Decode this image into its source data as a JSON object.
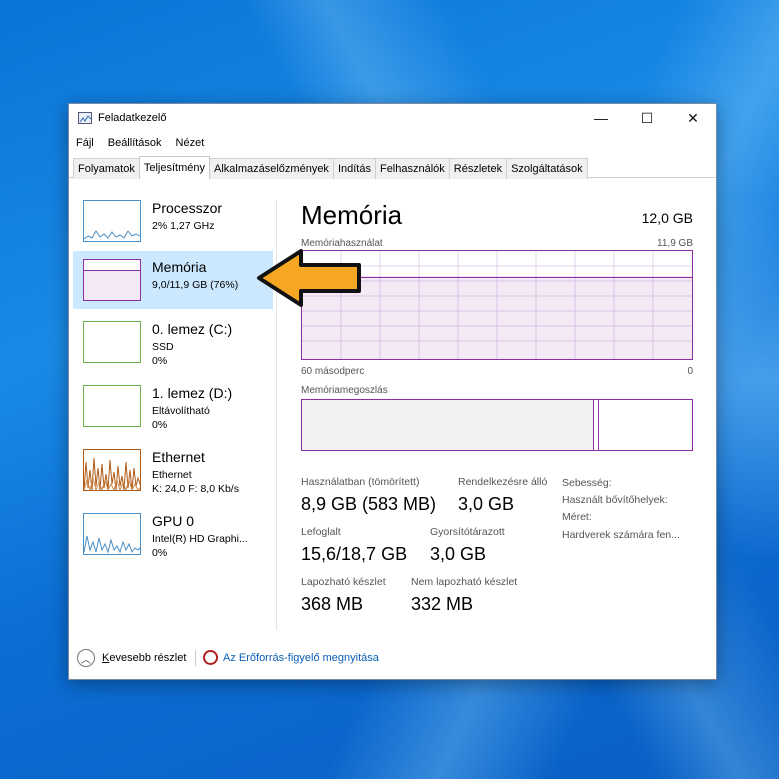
{
  "window": {
    "title": "Feladatkezelő",
    "controls": {
      "minimize": "—",
      "maximize": "☐",
      "close": "✕"
    }
  },
  "menu": [
    "Fájl",
    "Beállítások",
    "Nézet"
  ],
  "tabs": [
    {
      "label": "Folyamatok",
      "active": false
    },
    {
      "label": "Teljesítmény",
      "active": true
    },
    {
      "label": "Alkalmazáselőzmények",
      "active": false
    },
    {
      "label": "Indítás",
      "active": false
    },
    {
      "label": "Felhasználók",
      "active": false
    },
    {
      "label": "Részletek",
      "active": false
    },
    {
      "label": "Szolgáltatások",
      "active": false
    }
  ],
  "sidebar": {
    "items": [
      {
        "title": "Processzor",
        "lines": [
          "2% 1,27 GHz"
        ]
      },
      {
        "title": "Memória",
        "lines": [
          "9,0/11,9 GB (76%)"
        ],
        "selected": true
      },
      {
        "title": "0. lemez (C:)",
        "lines": [
          "SSD",
          "0%"
        ]
      },
      {
        "title": "1. lemez (D:)",
        "lines": [
          "Eltávolítható",
          "0%"
        ]
      },
      {
        "title": "Ethernet",
        "lines": [
          "Ethernet",
          "K: 24,0  F: 8,0 Kb/s"
        ]
      },
      {
        "title": "GPU 0",
        "lines": [
          "Intel(R) HD Graphi...",
          "0%"
        ]
      }
    ]
  },
  "main": {
    "title": "Memória",
    "total": "12,0 GB",
    "usage_label": "Memóriahasználat",
    "usage_max": "11,9 GB",
    "time_left": "60 másodperc",
    "time_right": "0",
    "composition_label": "Memóriamegoszlás",
    "usage_fraction": 0.76,
    "stats": {
      "in_use_label": "Használatban (tömörített)",
      "in_use_value": "8,9 GB (583 MB)",
      "available_label": "Rendelkezésre álló",
      "available_value": "3,0 GB",
      "committed_label": "Lefoglalt",
      "committed_value": "15,6/18,7 GB",
      "cached_label": "Gyorsítótárazott",
      "cached_value": "3,0 GB",
      "paged_label": "Lapozható készlet",
      "paged_value": "368 MB",
      "nonpaged_label": "Nem lapozható készlet",
      "nonpaged_value": "332 MB",
      "speed_label": "Sebesség:",
      "slots_label": "Használt bővítőhelyek:",
      "form_label": "Méret:",
      "reserved_label": "Hardverek számára fen..."
    }
  },
  "footer": {
    "fewer_details": "Kevesebb részlet",
    "fewer_underline": "K",
    "fewer_rest": "evesebb részlet",
    "resource_monitor": "Az Erőforrás-figyelő megnyitása"
  },
  "colors": {
    "memory_accent": "#8b2da6",
    "cpu_accent": "#4a8fc6",
    "disk_accent": "#6ab04c",
    "ethernet_accent": "#b05a16",
    "selection": "#cce8ff",
    "arrow_fill": "#f5a623"
  },
  "icons": {
    "app": "task-manager-icon",
    "chevron": "chevron-up-icon",
    "resource_monitor": "resource-monitor-icon",
    "pointer": "arrow-left-icon"
  }
}
